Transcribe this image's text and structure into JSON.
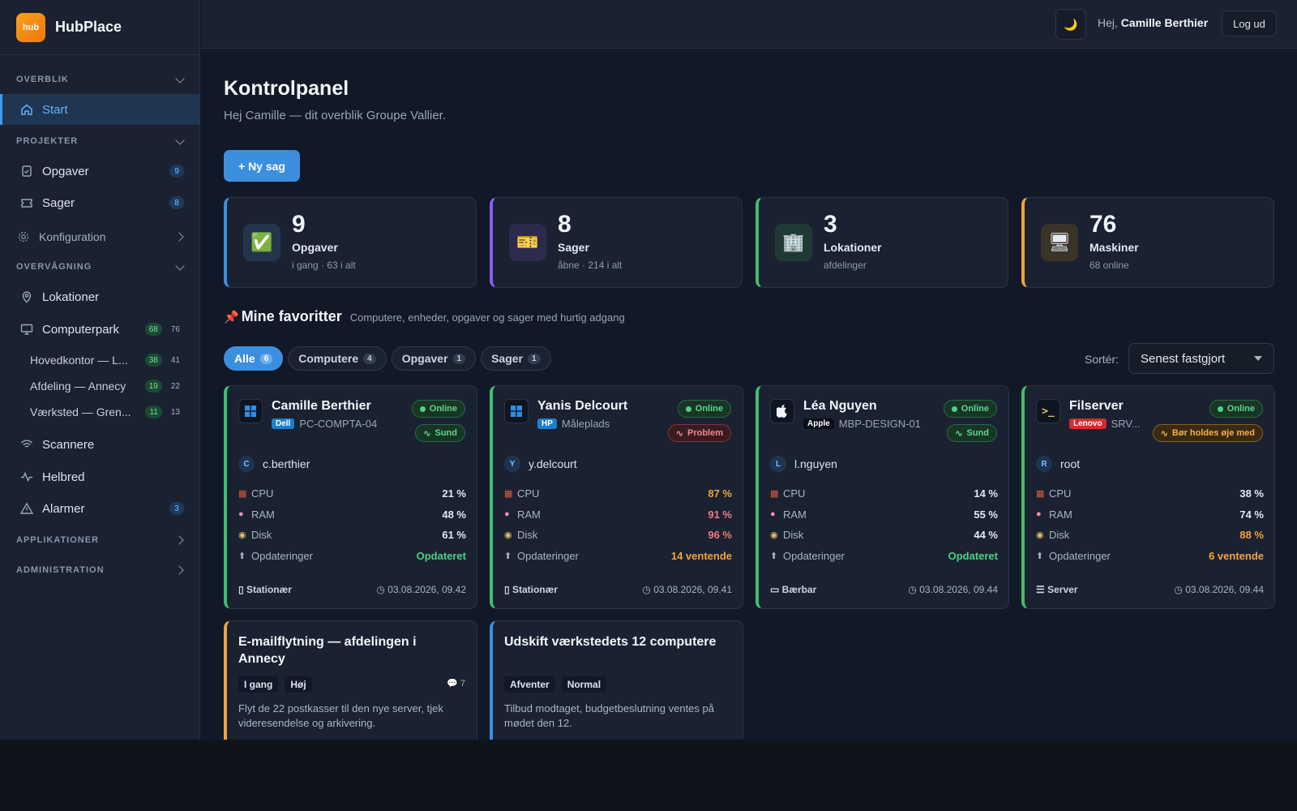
{
  "brand": {
    "logo_text": "hub",
    "name": "HubPlace"
  },
  "sidebar": {
    "sections": {
      "overblik": "OVERBLIK",
      "projekter": "PROJEKTER",
      "overvaagning": "OVERVÅGNING",
      "applikationer": "APPLIKATIONER",
      "administration": "ADMINISTRATION"
    },
    "items": {
      "start": "Start",
      "opgaver": {
        "label": "Opgaver",
        "count": "9"
      },
      "sager": {
        "label": "Sager",
        "count": "8"
      },
      "konfiguration": "Konfiguration",
      "lokationer": "Lokationer",
      "computerpark": {
        "label": "Computerpark",
        "online": "68",
        "total": "76"
      },
      "sub": [
        {
          "label": "Hovedkontor — L...",
          "online": "38",
          "total": "41"
        },
        {
          "label": "Afdeling — Annecy",
          "online": "19",
          "total": "22"
        },
        {
          "label": "Værksted — Gren...",
          "online": "11",
          "total": "13"
        }
      ],
      "scannere": "Scannere",
      "helbred": "Helbred",
      "alarmer": {
        "label": "Alarmer",
        "count": "3"
      }
    }
  },
  "topbar": {
    "theme_icon": "🌙",
    "greeting": "Hej, ",
    "user_name": "Camille Berthier",
    "logout": "Log ud"
  },
  "main": {
    "title": "Kontrolpanel",
    "subtitle": "Hej Camille — dit overblik Groupe Vallier.",
    "new_button": "+ Ny sag",
    "stats": [
      {
        "number": "9",
        "label": "Opgaver",
        "desc": "i gang · 63 i alt",
        "icon": "✅",
        "accent": "#3c8fde"
      },
      {
        "number": "8",
        "label": "Sager",
        "desc": "åbne · 214 i alt",
        "icon": "🎫",
        "accent": "#8b5cf6"
      },
      {
        "number": "3",
        "label": "Lokationer",
        "desc": "afdelinger",
        "icon": "🏢",
        "accent": "#3fbf6f"
      },
      {
        "number": "76",
        "label": "Maskiner",
        "desc": "68 online",
        "icon": "🖥",
        "accent": "#f2a33a"
      }
    ],
    "favorites": {
      "pin": "📌",
      "title": "Mine favoritter",
      "subtitle": "Computere, enheder, opgaver og sager med hurtig adgang",
      "filters": [
        {
          "label": "Alle",
          "count": "6"
        },
        {
          "label": "Computere",
          "count": "4"
        },
        {
          "label": "Opgaver",
          "count": "1"
        },
        {
          "label": "Sager",
          "count": "1"
        }
      ],
      "sort_label": "Sortér:",
      "sort_value": "Senest fastgjort"
    },
    "metric_labels": {
      "cpu": "CPU",
      "ram": "RAM",
      "disk": "Disk",
      "updates": "Opdateringer"
    },
    "machines": [
      {
        "name": "Camille Berthier",
        "brand": "Dell",
        "brand_color": "#1a7fd1",
        "host": "PC-COMPTA-04",
        "os": "windows",
        "status": "Online",
        "health": "Sund",
        "user_initial": "C",
        "user": "c.berthier",
        "cpu": "21 %",
        "ram": "48 %",
        "disk": "61 %",
        "updates": "Opdateret",
        "type": "Stationær",
        "time": "03.08.2026, 09.42"
      },
      {
        "name": "Yanis Delcourt",
        "brand": "HP",
        "brand_color": "#1a7fd1",
        "host": "Måleplads",
        "os": "windows",
        "status": "Online",
        "health": "Problem",
        "user_initial": "Y",
        "user": "y.delcourt",
        "cpu": "87 %",
        "ram": "91 %",
        "disk": "96 %",
        "updates": "14 ventende",
        "type": "Stationær",
        "time": "03.08.2026, 09.41"
      },
      {
        "name": "Léa Nguyen",
        "brand": "Apple",
        "brand_color": "#0b0f15",
        "host": "MBP-DESIGN-01",
        "os": "apple",
        "status": "Online",
        "health": "Sund",
        "user_initial": "L",
        "user": "l.nguyen",
        "cpu": "14 %",
        "ram": "55 %",
        "disk": "44 %",
        "updates": "Opdateret",
        "type": "Bærbar",
        "time": "03.08.2026, 09.44"
      },
      {
        "name": "Filserver",
        "brand": "Lenovo",
        "brand_color": "#d62c2c",
        "host": "SRV...",
        "os": "terminal",
        "status": "Online",
        "health": "Bør holdes øje med",
        "user_initial": "R",
        "user": "root",
        "cpu": "38 %",
        "ram": "74 %",
        "disk": "88 %",
        "updates": "6 ventende",
        "type": "Server",
        "time": "03.08.2026, 09.44"
      }
    ],
    "tasks": [
      {
        "title": "E-mailflytning — afdelingen i Annecy",
        "status": "I gang",
        "priority": "Høj",
        "comments": "7",
        "desc": "Flyt de 22 postkasser til den nye server, tjek videresendelse og arkivering.",
        "accent": "#f2a33a"
      },
      {
        "title": "Udskift værkstedets 12 computere",
        "status": "Afventer",
        "priority": "Normal",
        "desc": "Tilbud modtaget, budgetbeslutning ventes på mødet den 12.",
        "accent": "#3c8fde"
      }
    ]
  }
}
